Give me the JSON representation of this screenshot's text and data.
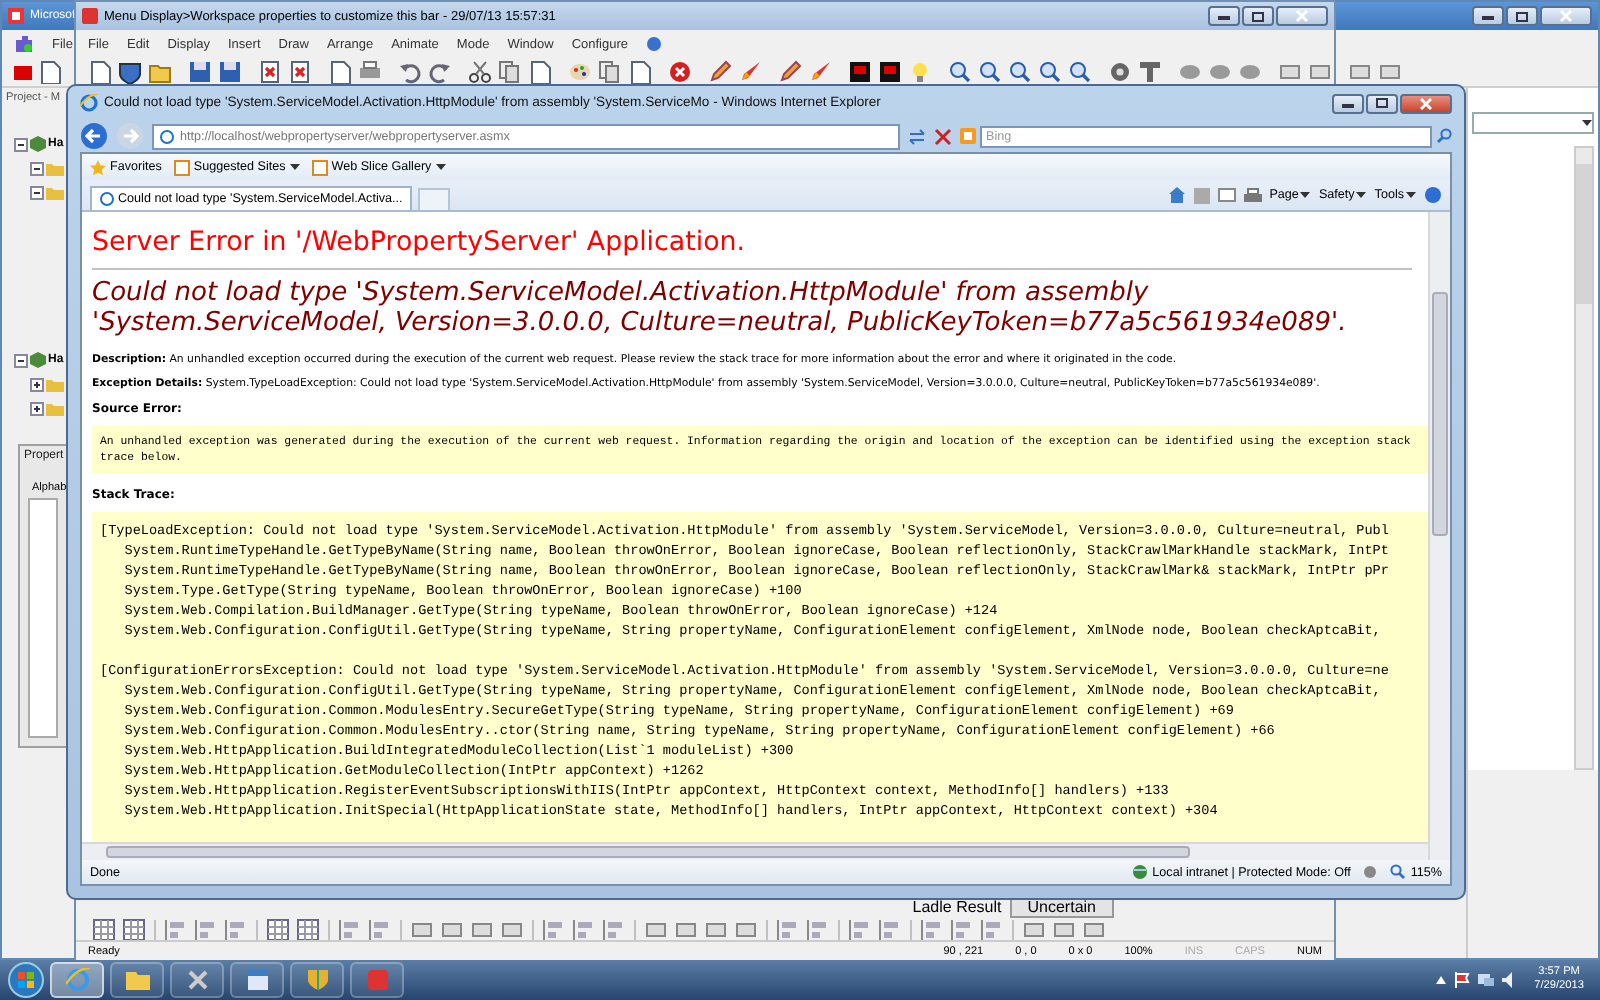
{
  "background_window": {
    "title": "Microsof",
    "menu": [
      {
        "label": "File"
      }
    ],
    "project_pane": {
      "title": "Project - M",
      "tree": [
        {
          "label": "Ha",
          "expanded": true,
          "children": [
            {
              "kind": "folder",
              "expanded": true
            },
            {
              "kind": "folder",
              "expanded": true
            }
          ]
        },
        {
          "label": "Ha",
          "expanded": true,
          "children": [
            {
              "kind": "folder",
              "expanded": false
            },
            {
              "kind": "folder",
              "expanded": false
            }
          ]
        }
      ]
    },
    "properties_pane": {
      "title": "Propert",
      "tab": "Alphab"
    }
  },
  "editor_window": {
    "title": "Menu Display>Workspace properties to customize this bar - 29/07/13 15:57:31",
    "menu": [
      "File",
      "Edit",
      "Display",
      "Insert",
      "Draw",
      "Arrange",
      "Animate",
      "Mode",
      "Window",
      "Configure"
    ],
    "field_label": "Ladle Result",
    "field_value": "Uncertain",
    "status_bar": [
      {
        "text": "Ready",
        "disabled": false
      },
      {
        "text": "90 , 221",
        "disabled": false
      },
      {
        "text": "0 , 0",
        "disabled": false
      },
      {
        "text": "0 x 0",
        "disabled": false
      },
      {
        "text": "100%",
        "disabled": false
      },
      {
        "text": "INS",
        "disabled": true
      },
      {
        "text": "CAPS",
        "disabled": true
      },
      {
        "text": "NUM",
        "disabled": false
      }
    ]
  },
  "browser_window": {
    "title": "Could not load type 'System.ServiceModel.Activation.HttpModule' from assembly 'System.ServiceMo - Windows Internet Explorer",
    "address": "http://localhost/webpropertyserver/webpropertyserver.asmx",
    "search": {
      "placeholder": "Bing"
    },
    "favorites_bar": [
      {
        "label": "Favorites",
        "kind": "favorites"
      },
      {
        "label": "Suggested Sites",
        "kind": "dropdown"
      },
      {
        "label": "Web Slice Gallery",
        "kind": "dropdown"
      }
    ],
    "tabs": [
      {
        "label": "Could not load type 'System.ServiceModel.Activa...",
        "selected": true
      }
    ],
    "command_bar": [
      {
        "label": "Page"
      },
      {
        "label": "Safety"
      },
      {
        "label": "Tools"
      }
    ],
    "page": {
      "heading": "Server Error in '/WebPropertyServer' Application.",
      "error_title": "Could not load type 'System.ServiceModel.Activation.HttpModule' from assembly 'System.ServiceModel, Version=3.0.0.0, Culture=neutral, PublicKeyToken=b77a5c561934e089'.",
      "details": [
        "**Description:** An unhandled exception occurred during the execution of the current web request. Please review the stack trace for more information about the error and where it originated in the code.",
        "**Exception Details:** System.TypeLoadException: Could not load type 'System.ServiceModel.Activation.HttpModule' from assembly 'System.ServiceModel, Version=3.0.0.0, Culture=neutral, PublicKeyToken=b77a5c561934e089'."
      ],
      "source_error": {
        "label": "Source Error:",
        "text": "An unhandled exception was generated during the execution of the current web request. Information regarding the origin and location of the exception can be identified using the exception stack trace below."
      },
      "stack_trace": {
        "label": "Stack Trace:",
        "groups": [
          [
            "[TypeLoadException: Could not load type 'System.ServiceModel.Activation.HttpModule' from assembly 'System.ServiceModel, Version=3.0.0.0, Culture=neutral, Publ",
            "   System.RuntimeTypeHandle.GetTypeByName(String name, Boolean throwOnError, Boolean ignoreCase, Boolean reflectionOnly, StackCrawlMarkHandle stackMark, IntPt",
            "   System.RuntimeTypeHandle.GetTypeByName(String name, Boolean throwOnError, Boolean ignoreCase, Boolean reflectionOnly, StackCrawlMark& stackMark, IntPtr pPr",
            "   System.Type.GetType(String typeName, Boolean throwOnError, Boolean ignoreCase) +100",
            "   System.Web.Compilation.BuildManager.GetType(String typeName, Boolean throwOnError, Boolean ignoreCase) +124",
            "   System.Web.Configuration.ConfigUtil.GetType(String typeName, String propertyName, ConfigurationElement configElement, XmlNode node, Boolean checkAptcaBit,"
          ],
          [
            "[ConfigurationErrorsException: Could not load type 'System.ServiceModel.Activation.HttpModule' from assembly 'System.ServiceModel, Version=3.0.0.0, Culture=ne",
            "   System.Web.Configuration.ConfigUtil.GetType(String typeName, String propertyName, ConfigurationElement configElement, XmlNode node, Boolean checkAptcaBit,",
            "   System.Web.Configuration.Common.ModulesEntry.SecureGetType(String typeName, String propertyName, ConfigurationElement configElement) +69",
            "   System.Web.Configuration.Common.ModulesEntry..ctor(String name, String typeName, String propertyName, ConfigurationElement configElement) +66",
            "   System.Web.HttpApplication.BuildIntegratedModuleCollection(List`1 moduleList) +300",
            "   System.Web.HttpApplication.GetModuleCollection(IntPtr appContext) +1262",
            "   System.Web.HttpApplication.RegisterEventSubscriptionsWithIIS(IntPtr appContext, HttpContext context, MethodInfo[] handlers) +133",
            "   System.Web.HttpApplication.InitSpecial(HttpApplicationState state, MethodInfo[] handlers, IntPtr appContext, HttpContext context) +304"
          ]
        ]
      }
    },
    "status_bar": {
      "text": "Done",
      "zone": "Local intranet | Protected Mode: Off",
      "zoom": "115%"
    }
  },
  "taskbar": {
    "apps": [
      {
        "kind": "browser",
        "active": true
      },
      {
        "kind": "folder",
        "active": false
      },
      {
        "kind": "tools",
        "active": false
      },
      {
        "kind": "window",
        "active": false
      },
      {
        "kind": "shield",
        "active": false
      },
      {
        "kind": "red-app",
        "active": false
      }
    ],
    "clock": {
      "time": "3:57 PM",
      "date": "7/29/2013"
    }
  }
}
